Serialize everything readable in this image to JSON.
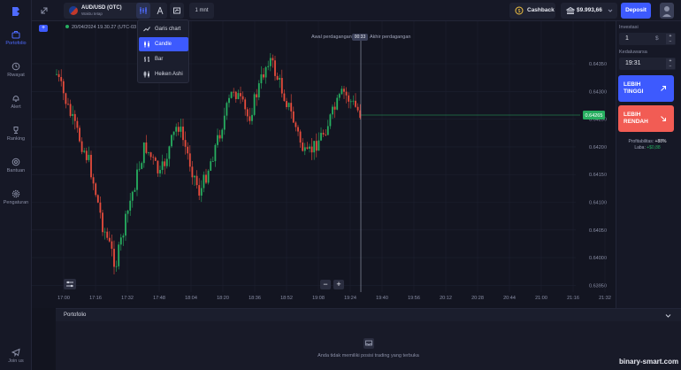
{
  "sidebar": {
    "items": [
      {
        "label": "Portofolio",
        "icon": "briefcase-icon",
        "active": true
      },
      {
        "label": "Riwayat",
        "icon": "history-icon"
      },
      {
        "label": "Alert",
        "icon": "bell-icon"
      },
      {
        "label": "Ranking",
        "icon": "trophy-icon"
      },
      {
        "label": "Bantuan",
        "icon": "help-icon"
      },
      {
        "label": "Pengaturan",
        "icon": "gear-icon"
      }
    ],
    "join": "Join us"
  },
  "topbar": {
    "asset_name": "AUD/USD (OTC)",
    "asset_sub": "Waktu tetap",
    "timeframe": "1 mnt",
    "cashback": "Cashback",
    "balance": "$9.993,66",
    "deposit": "Deposit"
  },
  "chart": {
    "datetime": "20/04/2024 19.30.27 (UTC-03",
    "period_start": "Awal perdagangan",
    "timer": "00:33",
    "period_end": "Akhir perdagangan",
    "current_price": "0.64265",
    "price_ticks": [
      "0.64350",
      "0.64300",
      "0.64250",
      "0.64200",
      "0.64150",
      "0.64100",
      "0.64050",
      "0.64000",
      "0.63950"
    ],
    "time_ticks": [
      "17:00",
      "17:16",
      "17:32",
      "17:48",
      "18:04",
      "18:20",
      "18:36",
      "18:52",
      "19:08",
      "19:24",
      "19:40",
      "19:56",
      "20:12",
      "20:28",
      "20:44",
      "21:00",
      "21:16",
      "21:32"
    ],
    "zoom_out": "−",
    "zoom_in": "+"
  },
  "chart_menu": {
    "items": [
      {
        "label": "Garis chart",
        "icon": "line-chart-icon"
      },
      {
        "label": "Candle",
        "icon": "candle-icon",
        "active": true
      },
      {
        "label": "Bar",
        "icon": "bar-chart-icon"
      },
      {
        "label": "Heiken Ashi",
        "icon": "heiken-ashi-icon"
      }
    ]
  },
  "trade": {
    "investment_label": "Investasi",
    "investment_value": "1",
    "currency": "$",
    "expiry_label": "Kedaluwarsa",
    "expiry_value": "19:31",
    "up_line1": "LEBIH",
    "up_line2": "TINGGI",
    "down_line1": "LEBIH",
    "down_line2": "RENDAH",
    "profitability_label": "Profitabilitas:",
    "profitability_value": "+88%",
    "profit_label": "Laba:",
    "profit_value": "+$0,88"
  },
  "portfolio": {
    "title": "Portofolio",
    "empty": "Anda tidak memiliki posisi trading yang terbuka"
  },
  "watermark": "binary-smart.com",
  "colors": {
    "accent": "#3d5afe",
    "up": "#27ae60",
    "down": "#e74c3c",
    "sell": "#f25c54"
  }
}
